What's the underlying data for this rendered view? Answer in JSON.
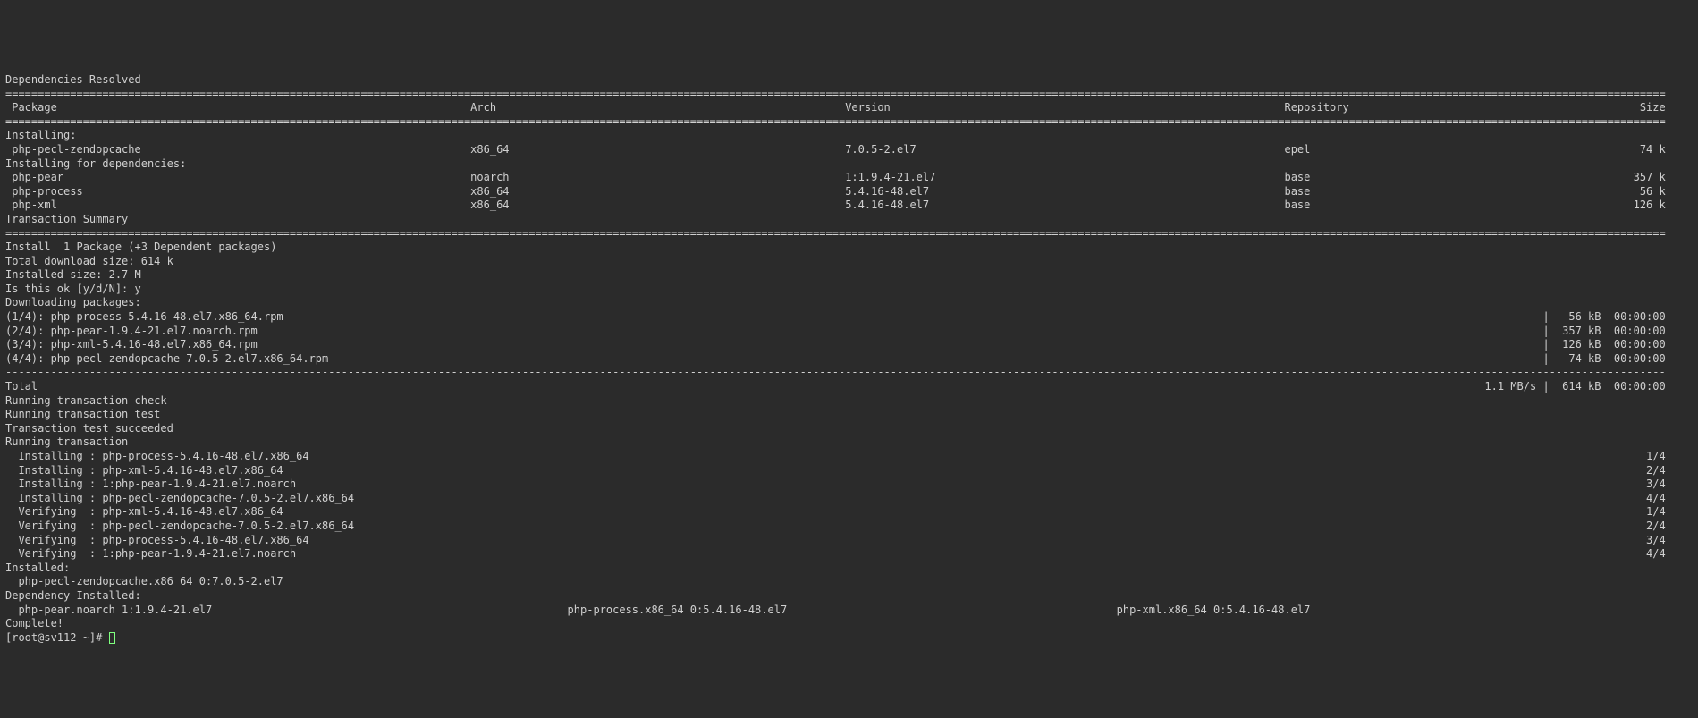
{
  "title": "Dependencies Resolved",
  "columns": {
    "package": "Package",
    "arch": "Arch",
    "version": "Version",
    "repo": "Repository",
    "size": "Size"
  },
  "sections": {
    "installing": "Installing:",
    "installing_deps": "Installing for dependencies:"
  },
  "packages_main": [
    {
      "name": "php-pecl-zendopcache",
      "arch": "x86_64",
      "version": "7.0.5-2.el7",
      "repo": "epel",
      "size": "74 k"
    }
  ],
  "packages_deps": [
    {
      "name": "php-pear",
      "arch": "noarch",
      "version": "1:1.9.4-21.el7",
      "repo": "base",
      "size": "357 k"
    },
    {
      "name": "php-process",
      "arch": "x86_64",
      "version": "5.4.16-48.el7",
      "repo": "base",
      "size": "56 k"
    },
    {
      "name": "php-xml",
      "arch": "x86_64",
      "version": "5.4.16-48.el7",
      "repo": "base",
      "size": "126 k"
    }
  ],
  "summary_header": "Transaction Summary",
  "summary_line": "Install  1 Package (+3 Dependent packages)",
  "totals": {
    "download": "Total download size: 614 k",
    "installed": "Installed size: 2.7 M",
    "confirm": "Is this ok [y/d/N]: y",
    "downloading": "Downloading packages:"
  },
  "downloads": [
    {
      "label": "(1/4): php-process-5.4.16-48.el7.x86_64.rpm",
      "size": "56 kB",
      "time": "00:00:00"
    },
    {
      "label": "(2/4): php-pear-1.9.4-21.el7.noarch.rpm",
      "size": "357 kB",
      "time": "00:00:00"
    },
    {
      "label": "(3/4): php-xml-5.4.16-48.el7.x86_64.rpm",
      "size": "126 kB",
      "time": "00:00:00"
    },
    {
      "label": "(4/4): php-pecl-zendopcache-7.0.5-2.el7.x86_64.rpm",
      "size": "74 kB",
      "time": "00:00:00"
    }
  ],
  "total_rate": {
    "label": "Total",
    "rate": "1.1 MB/s",
    "size": "614 kB",
    "time": "00:00:00"
  },
  "transaction": {
    "check": "Running transaction check",
    "test": "Running transaction test",
    "succeeded": "Transaction test succeeded",
    "running": "Running transaction"
  },
  "steps": [
    {
      "action": "Installing",
      "pkg": "php-process-5.4.16-48.el7.x86_64",
      "idx": "1/4"
    },
    {
      "action": "Installing",
      "pkg": "php-xml-5.4.16-48.el7.x86_64",
      "idx": "2/4"
    },
    {
      "action": "Installing",
      "pkg": "1:php-pear-1.9.4-21.el7.noarch",
      "idx": "3/4"
    },
    {
      "action": "Installing",
      "pkg": "php-pecl-zendopcache-7.0.5-2.el7.x86_64",
      "idx": "4/4"
    },
    {
      "action": "Verifying",
      "pkg": "php-xml-5.4.16-48.el7.x86_64",
      "idx": "1/4"
    },
    {
      "action": "Verifying",
      "pkg": "php-pecl-zendopcache-7.0.5-2.el7.x86_64",
      "idx": "2/4"
    },
    {
      "action": "Verifying",
      "pkg": "php-process-5.4.16-48.el7.x86_64",
      "idx": "3/4"
    },
    {
      "action": "Verifying",
      "pkg": "1:php-pear-1.9.4-21.el7.noarch",
      "idx": "4/4"
    }
  ],
  "installed_header": "Installed:",
  "installed_line": "php-pecl-zendopcache.x86_64 0:7.0.5-2.el7",
  "dep_installed_header": "Dependency Installed:",
  "dep_installed": [
    "php-pear.noarch 1:1.9.4-21.el7",
    "php-process.x86_64 0:5.4.16-48.el7",
    "php-xml.x86_64 0:5.4.16-48.el7"
  ],
  "complete": "Complete!",
  "prompt": "[root@sv112 ~]# "
}
